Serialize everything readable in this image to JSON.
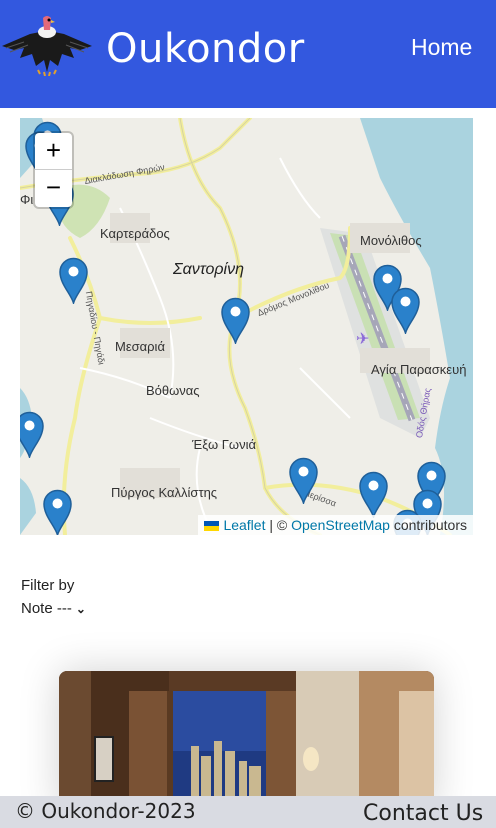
{
  "header": {
    "brand": "Oukondor",
    "nav_home": "Home",
    "logo_icon": "condor-bird-logo"
  },
  "map": {
    "zoom_in": "+",
    "zoom_out": "−",
    "labels": {
      "karterados": "Καρτεράδος",
      "santorini": "Σαντορίνη",
      "monolithos": "Μονόλιθος",
      "mesaria": "Μεσαριά",
      "vothonas": "Βόθωνας",
      "agia_paraskevi": "Αγία Παρασκευή",
      "exo_gonia": "Έξω Γωνιά",
      "pyrgos": "Πύργος Καλλίστης",
      "fira_partial": "Φι",
      "road_karterados": "Διακλάδωση Φηρών",
      "road_monolithou": "Δρόμος Μονολίθου",
      "road_perissa": "Περίσσα",
      "road_thiras": "Οδός Θήρας",
      "road_pigadi": "Πηγαδίου - Πηγάδι"
    },
    "attribution": {
      "leaflet": "Leaflet",
      "separator": " | © ",
      "osm": "OpenStreetMap",
      "suffix": " contributors"
    },
    "marker_color": "#2a81cb",
    "sea_color": "#aad3df"
  },
  "filter": {
    "label": "Filter by",
    "select_value": "Note ---",
    "chevron_icon": "chevron-down-icon"
  },
  "card": {
    "image": "hotel-room-photo"
  },
  "footer": {
    "copyright": "© Oukondor-2023",
    "contact": "Contact Us"
  },
  "colors": {
    "header_bg": "#3358df",
    "footer_bg": "#d9dbe2"
  }
}
